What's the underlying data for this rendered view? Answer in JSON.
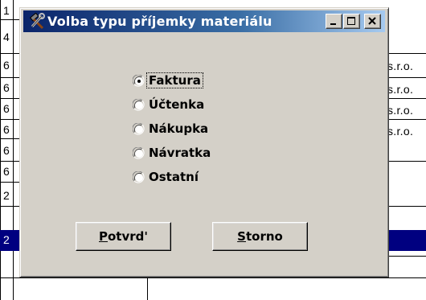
{
  "background": {
    "left_column": [
      "1",
      "4",
      "6",
      "6",
      "6",
      "6",
      "6",
      "6",
      "2",
      "2"
    ],
    "right_column": [
      "s.r.o.",
      "s.r.o.",
      "s.r.o.",
      "s.r.o."
    ],
    "selection_color": "#000080"
  },
  "dialog": {
    "title": "Volba typu příjemky materiálu",
    "title_icon": "tools-icon",
    "buttons": {
      "minimize_icon": "minimize-icon",
      "maximize_icon": "maximize-icon",
      "close_icon": "close-icon"
    },
    "options": [
      {
        "label": "Faktura",
        "selected": true
      },
      {
        "label": "Účtenka",
        "selected": false
      },
      {
        "label": "Nákupka",
        "selected": false
      },
      {
        "label": "Návratka",
        "selected": false
      },
      {
        "label": "Ostatní",
        "selected": false
      }
    ],
    "confirm": {
      "accel": "P",
      "rest": "otvrd'"
    },
    "cancel": {
      "accel": "S",
      "rest": "torno"
    }
  }
}
